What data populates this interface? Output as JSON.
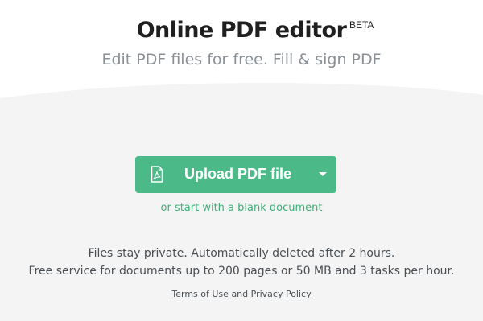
{
  "header": {
    "title": "Online PDF editor",
    "badge": "BETA",
    "subtitle": "Edit PDF files for free. Fill & sign PDF"
  },
  "upload": {
    "button_label": "Upload PDF file",
    "icon": "pdf-file-icon",
    "dropdown_icon": "caret-down-icon",
    "color": "#4cb988"
  },
  "blank_link": "or start with a blank document",
  "info": {
    "line1": "Files stay private. Automatically deleted after 2 hours.",
    "line2": "Free service for documents up to 200 pages or 50 MB and 3 tasks per hour."
  },
  "legal": {
    "terms": "Terms of Use",
    "and": "and",
    "privacy": "Privacy Policy"
  },
  "colors": {
    "background_band": "#f4f4f4",
    "link_green": "#3fae79"
  }
}
